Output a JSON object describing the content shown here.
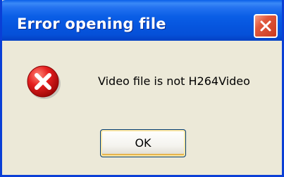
{
  "window": {
    "title": "Error opening file",
    "close_icon": "close-icon"
  },
  "dialog": {
    "icon": "error-icon",
    "message": "Video file is not H264Video",
    "ok_label": "OK"
  },
  "colors": {
    "titlebar": "#0a5ee6",
    "frame": "#0a3fd6",
    "background": "#ece9d8",
    "close_button": "#e1583d",
    "error_icon": "#d01010"
  }
}
